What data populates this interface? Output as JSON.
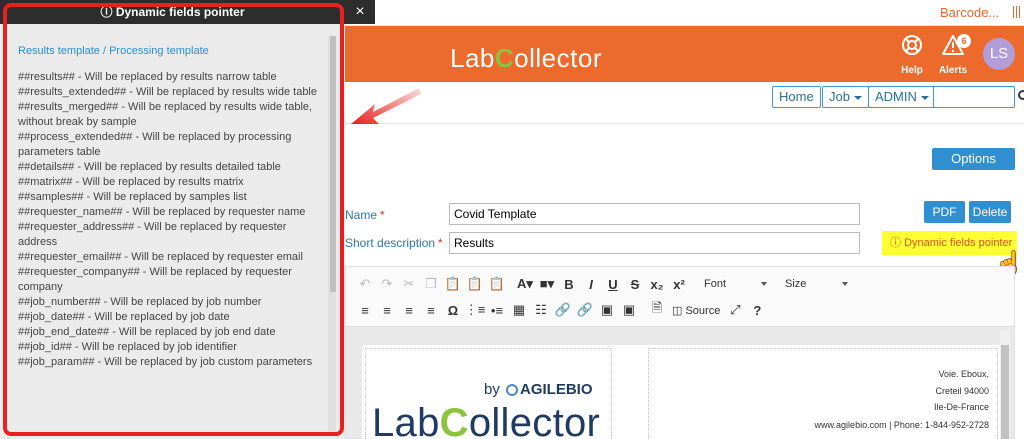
{
  "topbar": {
    "barcode_link": "Barcode..."
  },
  "header": {
    "logo_text_left": "Lab",
    "logo_text_c": "C",
    "logo_text_right": "ollector",
    "help_label": "Help",
    "alerts_label": "Alerts",
    "alerts_count": "6",
    "avatar_initials": "LS"
  },
  "nav": {
    "home": "Home",
    "job": "Job",
    "admin": "ADMIN",
    "search_value": ""
  },
  "options_label": "Options",
  "form": {
    "name_label": "Name",
    "name_value": "Covid Template",
    "short_label": "Short description",
    "short_value": "Results",
    "required_mark": "*",
    "pdf_label": "PDF",
    "delete_label": "Delete",
    "dynamic_fields_link": "Dynamic fields pointer"
  },
  "toolbar": {
    "font_select": "Font",
    "size_select": "Size",
    "source_label": "Source"
  },
  "preview": {
    "by": "by",
    "agilebio": "AGILEBIO",
    "logo_left": "Lab",
    "logo_c": "C",
    "logo_right": "ollector",
    "address1": "Voie. Eboux,",
    "address2": "Creteil 94000",
    "address3": "Ile-De-France",
    "address4": "www.agilebio.com | Phone: 1-844-952-2728"
  },
  "dynamic_panel": {
    "title": "Dynamic fields pointer",
    "close": "×",
    "heading": "Results template / Processing template",
    "items": [
      "##results## - Will be replaced by results narrow table",
      "##results_extended## - Will be replaced by results wide table",
      "##results_merged## - Will be replaced by results wide table, without break by sample",
      "##process_extended## - Will be replaced by processing parameters table",
      "##details## - Will be replaced by results detailed table",
      "##matrix## - Will be replaced by results matrix",
      "##samples## - Will be replaced by samples list",
      "##requester_name## - Will be replaced by requester name",
      "##requester_address## - Will be replaced by requester address",
      "##requester_email## - Will be replaced by requester email",
      "##requester_company## - Will be replaced by requester company",
      "##job_number## - Will be replaced by job number",
      "##job_date## - Will be replaced by job date",
      "##job_end_date## - Will be replaced by job end date",
      "##job_id## - Will be replaced by job identifier",
      "##job_param## - Will be replaced by job custom parameters"
    ]
  },
  "colors": {
    "header_orange": "#ec6a2c",
    "accent_blue": "#2f8fd0",
    "highlight_yellow": "#ffff33",
    "annotation_red": "#e8201e",
    "logo_green": "#8ac43f"
  }
}
